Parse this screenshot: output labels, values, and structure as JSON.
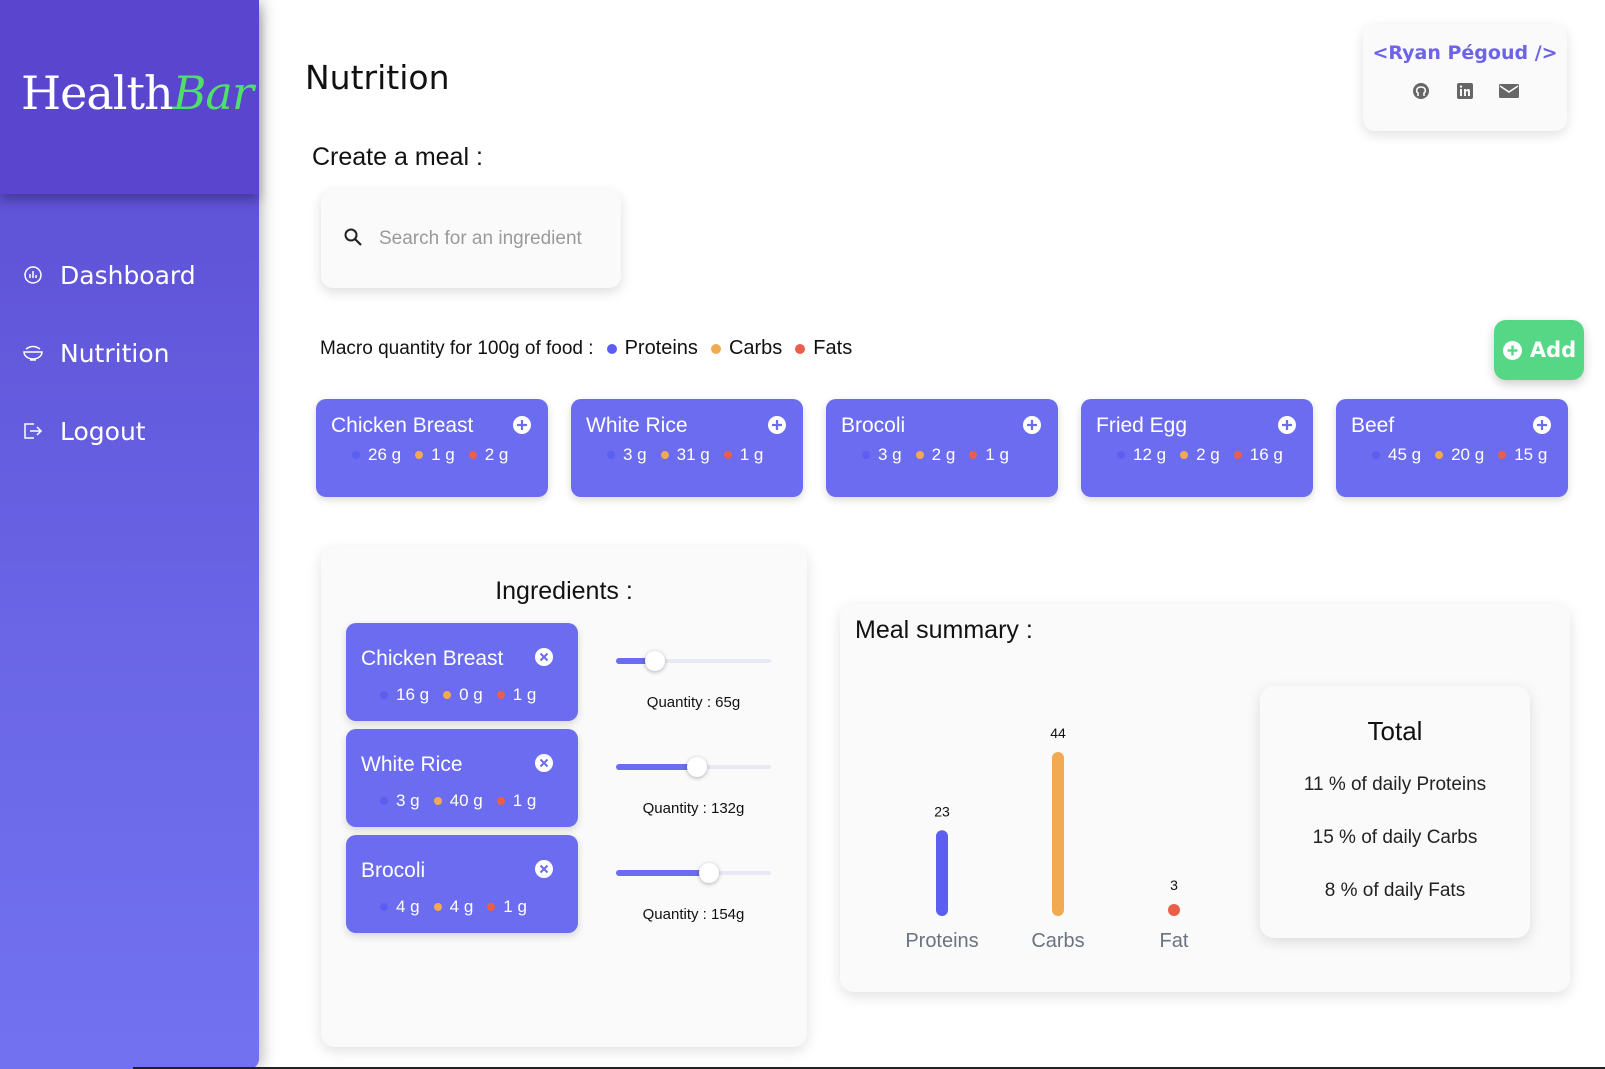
{
  "app": {
    "brand_main": "Health",
    "brand_accent": "Bar"
  },
  "sidebar": {
    "items": [
      {
        "label": "Dashboard",
        "icon": "dashboard-icon"
      },
      {
        "label": "Nutrition",
        "icon": "bowl-icon"
      },
      {
        "label": "Logout",
        "icon": "logout-icon"
      }
    ]
  },
  "header": {
    "title": "Nutrition"
  },
  "profile": {
    "name": "<Ryan Pégoud />",
    "icons": [
      "github-icon",
      "linkedin-icon",
      "mail-icon"
    ]
  },
  "create": {
    "title": "Create a meal :",
    "search_placeholder": "Search for an ingredient"
  },
  "legend": {
    "label": "Macro quantity for 100g of food :",
    "proteins": "Proteins",
    "carbs": "Carbs",
    "fats": "Fats"
  },
  "add_button": {
    "label": "Add"
  },
  "foods": [
    {
      "name": "Chicken Breast",
      "p": "26 g",
      "c": "1 g",
      "f": "2 g"
    },
    {
      "name": "White Rice",
      "p": "3 g",
      "c": "31 g",
      "f": "1 g"
    },
    {
      "name": "Brocoli",
      "p": "3 g",
      "c": "2 g",
      "f": "1 g"
    },
    {
      "name": "Fried Egg",
      "p": "12 g",
      "c": "2 g",
      "f": "16 g"
    },
    {
      "name": "Beef",
      "p": "45 g",
      "c": "20 g",
      "f": "15 g"
    }
  ],
  "ingredients": {
    "title": "Ingredients :",
    "items": [
      {
        "name": "Chicken Breast",
        "p": "16 g",
        "c": "0 g",
        "f": "1 g",
        "quantity": "Quantity : 65g",
        "slider_fraction": 0.25
      },
      {
        "name": "White Rice",
        "p": "3 g",
        "c": "40 g",
        "f": "1 g",
        "quantity": "Quantity : 132g",
        "slider_fraction": 0.52
      },
      {
        "name": "Brocoli",
        "p": "4 g",
        "c": "4 g",
        "f": "1 g",
        "quantity": "Quantity : 154g",
        "slider_fraction": 0.6
      }
    ]
  },
  "summary": {
    "title": "Meal summary :",
    "total_title": "Total",
    "lines": [
      "11 % of daily Proteins",
      "15 % of daily Carbs",
      "8 % of daily Fats"
    ]
  },
  "colors": {
    "protein": "#5b5ef0",
    "carbs": "#f2aa52",
    "fats": "#ea5f4a",
    "accent": "#6c6cf0",
    "add_green": "#55d785"
  },
  "chart_data": {
    "type": "bar",
    "categories": [
      "Proteins",
      "Carbs",
      "Fat"
    ],
    "values": [
      23,
      44,
      3
    ],
    "colors": [
      "#5b5ef0",
      "#f2aa52",
      "#ea5f4a"
    ],
    "ylim": [
      0,
      44
    ],
    "grid": false
  }
}
